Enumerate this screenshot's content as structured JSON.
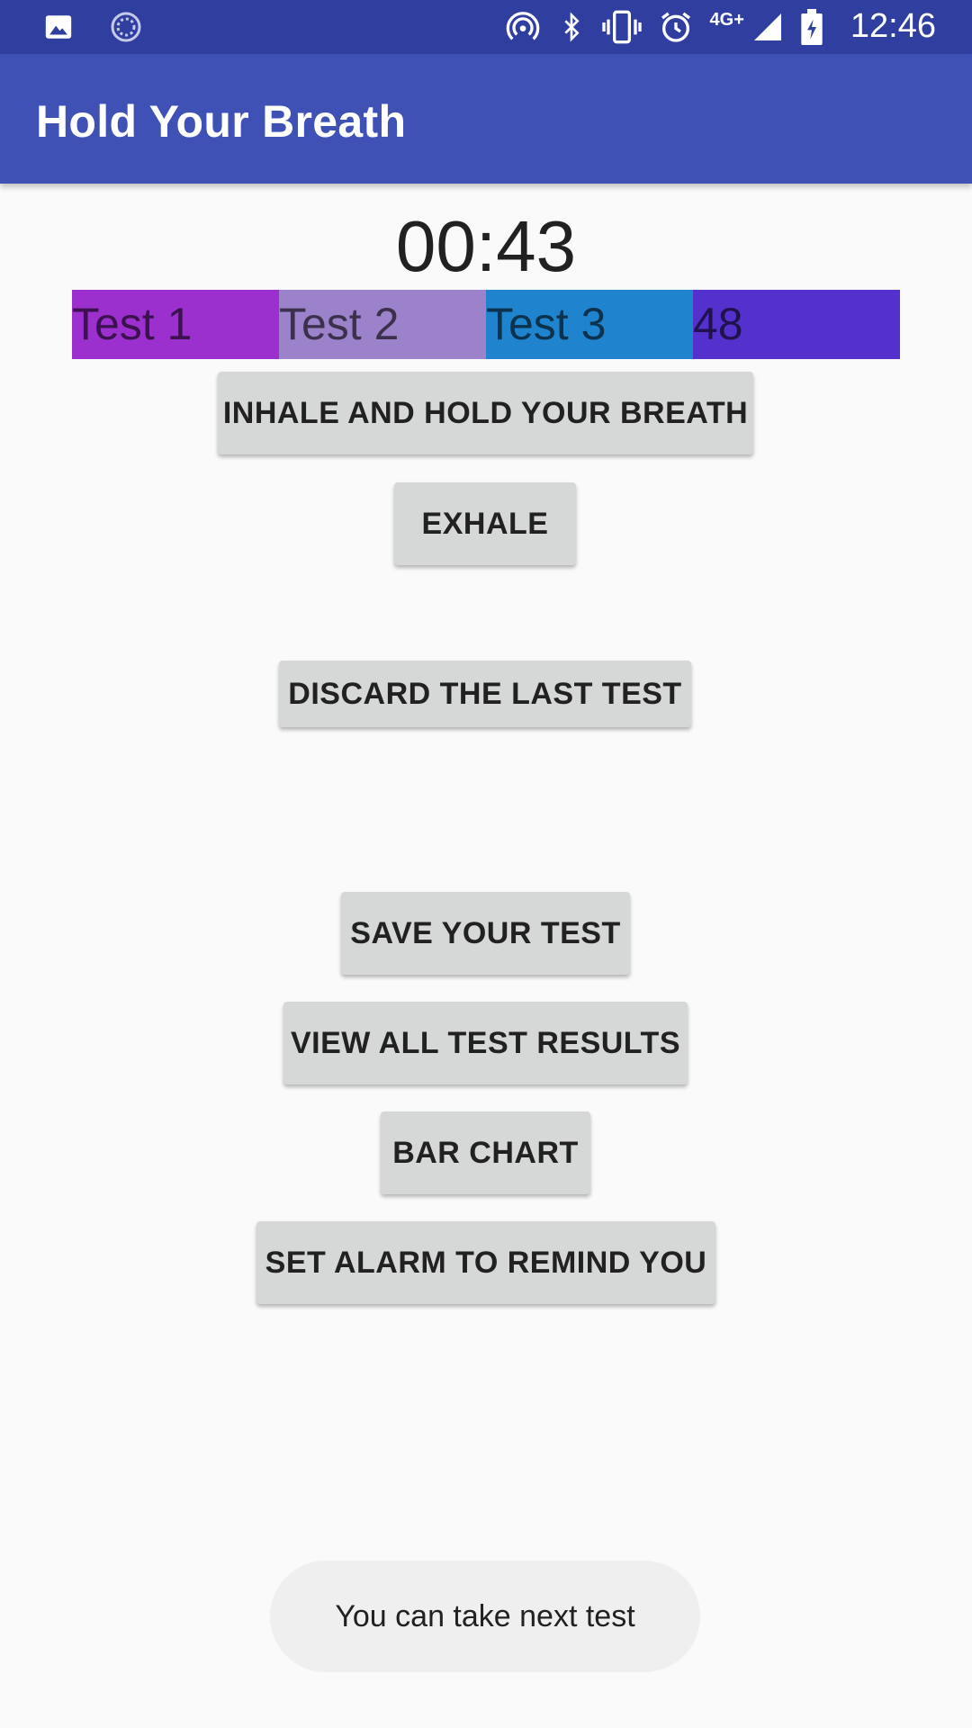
{
  "status_bar": {
    "time": "12:46",
    "network": "4G+",
    "icons": [
      "image-icon",
      "sync-icon",
      "hotspot-icon",
      "bluetooth-icon",
      "vibrate-icon",
      "alarm-icon",
      "signal-icon",
      "battery-icon"
    ]
  },
  "app_bar": {
    "title": "Hold Your Breath",
    "color": "#3f51b5"
  },
  "timer": {
    "value": "00:43"
  },
  "results": [
    {
      "label": "Test 1",
      "color": "#9c30cf"
    },
    {
      "label": "Test 2",
      "color": "#9b82cb"
    },
    {
      "label": "Test 3",
      "color": "#2083ce"
    },
    {
      "label": "48",
      "color": "#5431cc"
    }
  ],
  "buttons": {
    "inhale": "INHALE AND HOLD YOUR BREATH",
    "exhale": "EXHALE",
    "discard": "DISCARD THE LAST TEST",
    "save": "SAVE YOUR TEST",
    "view_all": "VIEW ALL TEST RESULTS",
    "bar_chart": "BAR CHART",
    "set_alarm": "SET ALARM TO REMIND YOU"
  },
  "toast": {
    "message": "You can take next test"
  }
}
